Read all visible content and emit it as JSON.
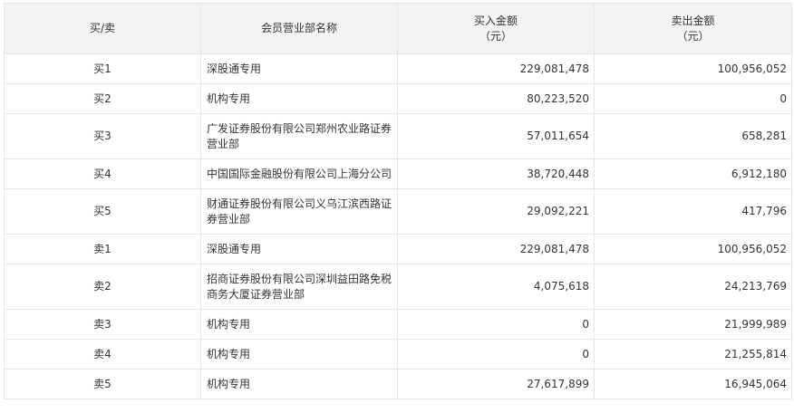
{
  "headers": {
    "type": "买/卖",
    "name": "会员营业部名称",
    "buy_line1": "买入金额",
    "buy_line2": "（元）",
    "sell_line1": "卖出金额",
    "sell_line2": "（元）"
  },
  "rows": [
    {
      "type": "买1",
      "name": "深股通专用",
      "buy": "229,081,478",
      "sell": "100,956,052"
    },
    {
      "type": "买2",
      "name": "机构专用",
      "buy": "80,223,520",
      "sell": "0"
    },
    {
      "type": "买3",
      "name": "广发证券股份有限公司郑州农业路证券营业部",
      "buy": "57,011,654",
      "sell": "658,281"
    },
    {
      "type": "买4",
      "name": "中国国际金融股份有限公司上海分公司",
      "buy": "38,720,448",
      "sell": "6,912,180"
    },
    {
      "type": "买5",
      "name": "财通证券股份有限公司义乌江滨西路证券营业部",
      "buy": "29,092,221",
      "sell": "417,796"
    },
    {
      "type": "卖1",
      "name": "深股通专用",
      "buy": "229,081,478",
      "sell": "100,956,052"
    },
    {
      "type": "卖2",
      "name": "招商证券股份有限公司深圳益田路免税商务大厦证券营业部",
      "buy": "4,075,618",
      "sell": "24,213,769"
    },
    {
      "type": "卖3",
      "name": "机构专用",
      "buy": "0",
      "sell": "21,999,989"
    },
    {
      "type": "卖4",
      "name": "机构专用",
      "buy": "0",
      "sell": "21,255,814"
    },
    {
      "type": "卖5",
      "name": "机构专用",
      "buy": "27,617,899",
      "sell": "16,945,064"
    }
  ],
  "colors": {
    "header_bg": "#f3f3f3",
    "border": "#e6e6e6",
    "text": "#333333"
  }
}
